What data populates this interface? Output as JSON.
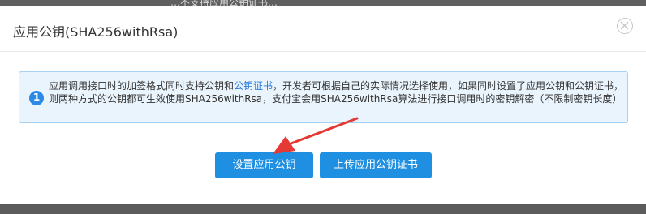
{
  "backdrop": {
    "text": "…不支持应用公钥证书…"
  },
  "dialog": {
    "title": "应用公钥(SHA256withRsa)",
    "close_icon": "close-icon"
  },
  "notice": {
    "icon_label": "1",
    "text_before_link": "应用调用接口时的加签格式同时支持公钥和",
    "link_text": "公钥证书",
    "text_after_link": "，开发者可根据自己的实际情况选择使用，如果同时设置了应用公钥和公钥证书，则两种方式的公钥都可生效使用SHA256withRsa，支付宝会用SHA256withRsa算法进行接口调用时的密钥解密（不限制密钥长度）"
  },
  "buttons": {
    "set_public_key": "设置应用公钥",
    "upload_certificate": "上传应用公钥证书"
  },
  "annotation": {
    "arrow_color": "#e53935"
  }
}
